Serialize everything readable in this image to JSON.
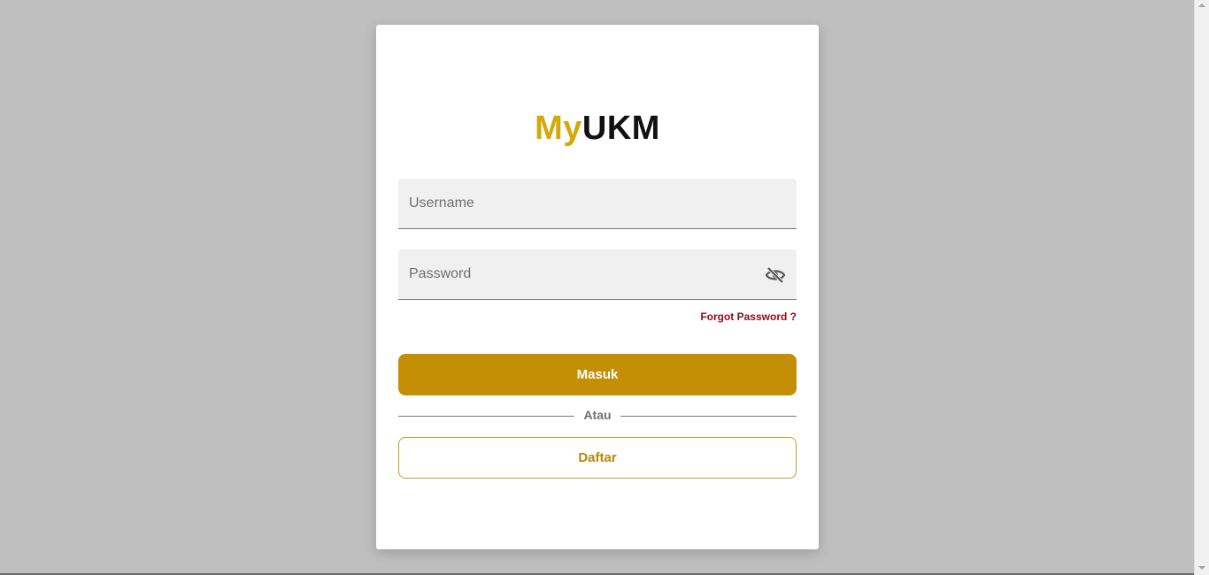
{
  "logo": {
    "part1": "My",
    "part2": "UKM",
    "part1_color": "#d4a90a",
    "part2_color": "#111111"
  },
  "form": {
    "username": {
      "placeholder": "Username",
      "value": ""
    },
    "password": {
      "placeholder": "Password",
      "value": "",
      "toggle_icon": "eye-off-icon"
    },
    "forgot_label": "Forgot Password ?",
    "login_label": "Masuk",
    "divider_label": "Atau",
    "register_label": "Daftar"
  },
  "colors": {
    "background": "#bfbfbf",
    "card": "#ffffff",
    "primary": "#c58f05",
    "link": "#8b0a1a"
  }
}
